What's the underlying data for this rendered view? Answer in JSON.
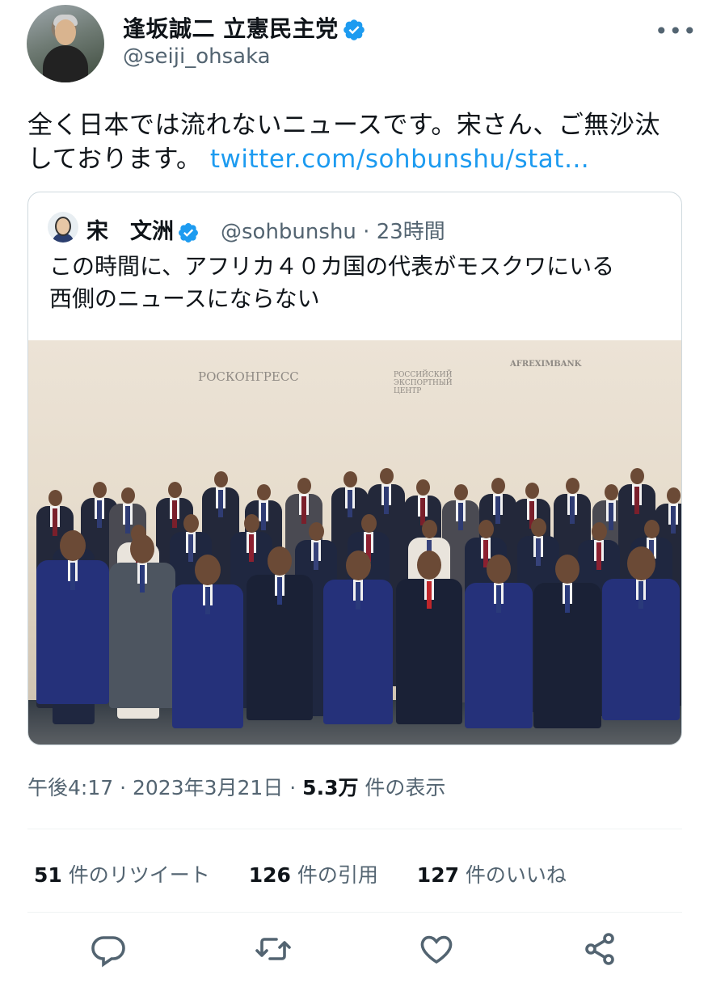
{
  "tweet": {
    "author_name": "逢坂誠二 立憲民主党",
    "author_handle": "@seiji_ohsaka",
    "text": "全く日本では流れないニュースです。宋さん、ご無沙汰しております。",
    "link_text": "twitter.com/sohbunshu/stat…",
    "more_label": "•••"
  },
  "quote": {
    "author_name": "宋　文洲",
    "author_handle": "@sohbunshu · 23時間",
    "text_line1": "この時間に、アフリカ４０カ国の代表がモスクワにいる",
    "text_line2": "西側のニュースにならない",
    "photo_logos": [
      "РОСКОНГРЕСС",
      "РОССИЙСКИЙ ЭКСПОРТНЫЙ ЦЕНТР",
      "AFREXIMBANK"
    ]
  },
  "meta": {
    "timestamp": "午後4:17 · 2023年3月21日 · ",
    "views_count": "5.3万",
    "views_label": " 件の表示"
  },
  "stats": {
    "retweets_count": "51",
    "retweets_label": " 件のリツイート",
    "quotes_count": "126",
    "quotes_label": " 件の引用",
    "likes_count": "127",
    "likes_label": " 件のいいね"
  },
  "actions": [
    "reply-icon",
    "retweet-icon",
    "like-icon",
    "share-icon"
  ],
  "colors": {
    "accent": "#1d9bf0",
    "secondary_text": "#536471",
    "divider": "#eff3f4"
  }
}
